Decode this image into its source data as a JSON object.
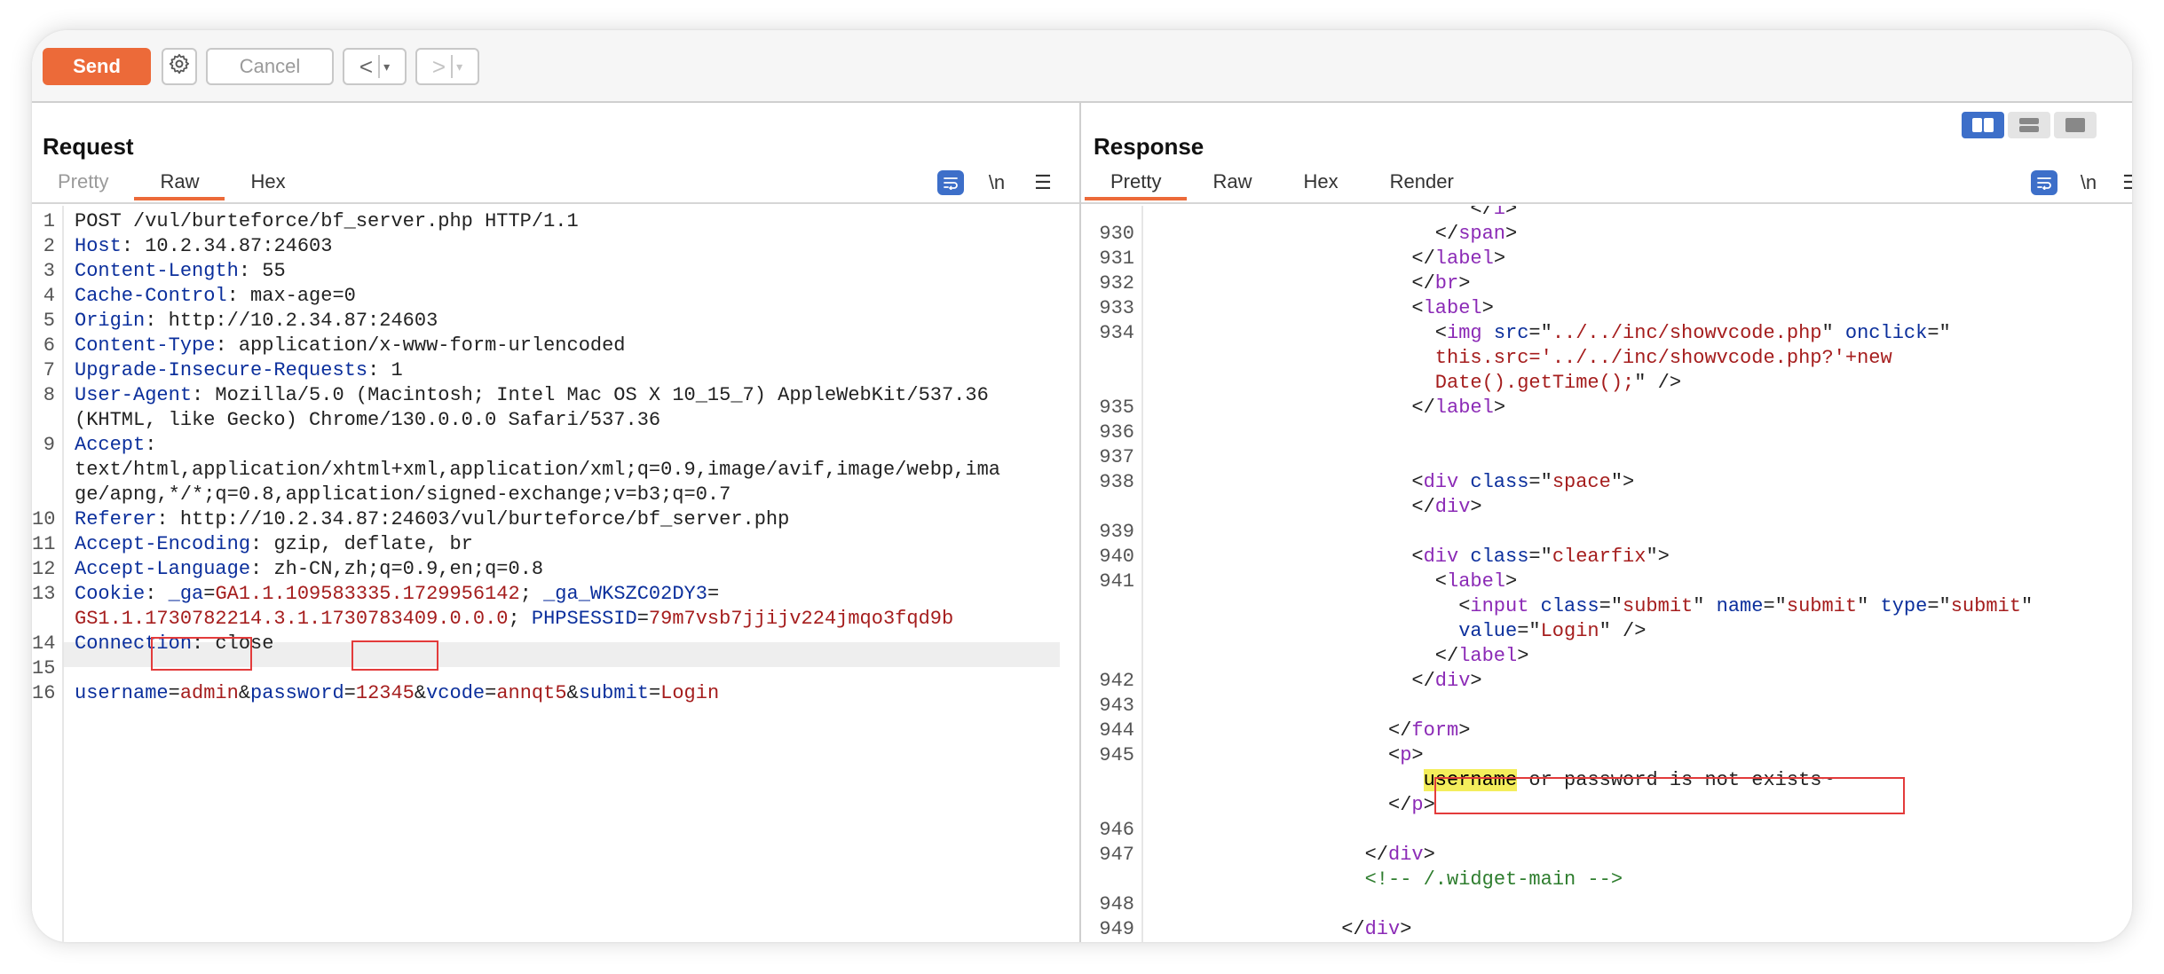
{
  "toolbar": {
    "send_label": "Send",
    "cancel_label": "Cancel",
    "prev_label": "<",
    "next_label": ">",
    "dropdown_glyph": "▾",
    "settings_icon": "gear-icon"
  },
  "request": {
    "title": "Request",
    "tabs": [
      "Pretty",
      "Raw",
      "Hex"
    ],
    "active_tab": "Raw",
    "newline_label": "\\n",
    "lines": [
      {
        "n": "1",
        "parts": [
          [
            "v",
            "POST /vul/burteforce/bf_server.php HTTP/1.1"
          ]
        ]
      },
      {
        "n": "2",
        "parts": [
          [
            "k",
            "Host"
          ],
          [
            "v",
            ": 10.2.34.87:24603"
          ]
        ]
      },
      {
        "n": "3",
        "parts": [
          [
            "k",
            "Content-Length"
          ],
          [
            "v",
            ": 55"
          ]
        ]
      },
      {
        "n": "4",
        "parts": [
          [
            "k",
            "Cache-Control"
          ],
          [
            "v",
            ": max-age=0"
          ]
        ]
      },
      {
        "n": "5",
        "parts": [
          [
            "k",
            "Origin"
          ],
          [
            "v",
            ": http://10.2.34.87:24603"
          ]
        ]
      },
      {
        "n": "6",
        "parts": [
          [
            "k",
            "Content-Type"
          ],
          [
            "v",
            ": application/x-www-form-urlencoded"
          ]
        ]
      },
      {
        "n": "7",
        "parts": [
          [
            "k",
            "Upgrade-Insecure-Requests"
          ],
          [
            "v",
            ": 1"
          ]
        ]
      },
      {
        "n": "8",
        "parts": [
          [
            "k",
            "User-Agent"
          ],
          [
            "v",
            ": Mozilla/5.0 (Macintosh; Intel Mac OS X 10_15_7) AppleWebKit/537.36"
          ]
        ]
      },
      {
        "n": "",
        "parts": [
          [
            "v",
            "(KHTML, like Gecko) Chrome/130.0.0.0 Safari/537.36"
          ]
        ]
      },
      {
        "n": "9",
        "parts": [
          [
            "k",
            "Accept"
          ],
          [
            "v",
            ":"
          ]
        ]
      },
      {
        "n": "",
        "parts": [
          [
            "v",
            "text/html,application/xhtml+xml,application/xml;q=0.9,image/avif,image/webp,ima"
          ]
        ]
      },
      {
        "n": "",
        "parts": [
          [
            "v",
            "ge/apng,*/*;q=0.8,application/signed-exchange;v=b3;q=0.7"
          ]
        ]
      },
      {
        "n": "10",
        "parts": [
          [
            "k",
            "Referer"
          ],
          [
            "v",
            ": http://10.2.34.87:24603/vul/burteforce/bf_server.php"
          ]
        ]
      },
      {
        "n": "11",
        "parts": [
          [
            "k",
            "Accept-Encoding"
          ],
          [
            "v",
            ": gzip, deflate, br"
          ]
        ]
      },
      {
        "n": "12",
        "parts": [
          [
            "k",
            "Accept-Language"
          ],
          [
            "v",
            ": zh-CN,zh;q=0.9,en;q=0.8"
          ]
        ]
      },
      {
        "n": "13",
        "parts": [
          [
            "k",
            "Cookie"
          ],
          [
            "v",
            ": "
          ],
          [
            "k",
            "_ga"
          ],
          [
            "v",
            "="
          ],
          [
            "r",
            "GA1.1.109583335.1729956142"
          ],
          [
            "v",
            "; "
          ],
          [
            "k",
            "_ga_WKSZC02DY3"
          ],
          [
            "v",
            "="
          ]
        ]
      },
      {
        "n": "",
        "parts": [
          [
            "r",
            "GS1.1.1730782214.3.1.1730783409.0.0.0"
          ],
          [
            "v",
            "; "
          ],
          [
            "k",
            "PHPSESSID"
          ],
          [
            "v",
            "="
          ],
          [
            "r",
            "79m7vsb7jjijv224jmqo3fqd9b"
          ]
        ]
      },
      {
        "n": "14",
        "parts": [
          [
            "k",
            "Connection"
          ],
          [
            "v",
            ": close"
          ]
        ]
      },
      {
        "n": "15",
        "parts": []
      },
      {
        "n": "16",
        "parts": [
          [
            "k",
            "username"
          ],
          [
            "v",
            "="
          ],
          [
            "r",
            "admin"
          ],
          [
            "v",
            "&"
          ],
          [
            "k",
            "password"
          ],
          [
            "v",
            "="
          ],
          [
            "r",
            "12345"
          ],
          [
            "v",
            "&"
          ],
          [
            "k",
            "vcode"
          ],
          [
            "v",
            "="
          ],
          [
            "r",
            "annqt5"
          ],
          [
            "v",
            "&"
          ],
          [
            "k",
            "submit"
          ],
          [
            "v",
            "="
          ],
          [
            "r",
            "Login"
          ]
        ]
      }
    ]
  },
  "response": {
    "title": "Response",
    "tabs": [
      "Pretty",
      "Raw",
      "Hex",
      "Render"
    ],
    "active_tab": "Pretty",
    "newline_label": "\\n",
    "lines": [
      {
        "n": "",
        "indent": 27,
        "parts": [
          [
            "p",
            "</"
          ],
          [
            "t",
            "i"
          ],
          [
            "p",
            ">"
          ]
        ]
      },
      {
        "n": "930",
        "indent": 24,
        "parts": [
          [
            "p",
            "</"
          ],
          [
            "t",
            "span"
          ],
          [
            "p",
            ">"
          ]
        ]
      },
      {
        "n": "931",
        "indent": 22,
        "parts": [
          [
            "p",
            "</"
          ],
          [
            "t",
            "label"
          ],
          [
            "p",
            ">"
          ]
        ]
      },
      {
        "n": "932",
        "indent": 22,
        "parts": [
          [
            "p",
            "</"
          ],
          [
            "t",
            "br"
          ],
          [
            "p",
            ">"
          ]
        ]
      },
      {
        "n": "933",
        "indent": 22,
        "parts": [
          [
            "p",
            "<"
          ],
          [
            "t",
            "label"
          ],
          [
            "p",
            ">"
          ]
        ]
      },
      {
        "n": "934",
        "indent": 24,
        "parts": [
          [
            "p",
            "<"
          ],
          [
            "t",
            "img"
          ],
          [
            "p",
            " "
          ],
          [
            "a",
            "src"
          ],
          [
            "p",
            "=\""
          ],
          [
            "s",
            "../../inc/showvcode.php"
          ],
          [
            "p",
            "\" "
          ],
          [
            "a",
            "onclick"
          ],
          [
            "p",
            "=\""
          ]
        ]
      },
      {
        "n": "",
        "indent": 24,
        "parts": [
          [
            "s",
            "this.src='../../inc/showvcode.php?'+new"
          ]
        ]
      },
      {
        "n": "",
        "indent": 24,
        "parts": [
          [
            "s",
            "Date().getTime();"
          ],
          [
            "p",
            "\" />"
          ]
        ]
      },
      {
        "n": "935",
        "indent": 22,
        "parts": [
          [
            "p",
            "</"
          ],
          [
            "t",
            "label"
          ],
          [
            "p",
            ">"
          ]
        ]
      },
      {
        "n": "936",
        "indent": 0,
        "parts": []
      },
      {
        "n": "937",
        "indent": 0,
        "parts": []
      },
      {
        "n": "938",
        "indent": 22,
        "parts": [
          [
            "p",
            "<"
          ],
          [
            "t",
            "div"
          ],
          [
            "p",
            " "
          ],
          [
            "a",
            "class"
          ],
          [
            "p",
            "=\""
          ],
          [
            "s",
            "space"
          ],
          [
            "p",
            "\">"
          ]
        ]
      },
      {
        "n": "",
        "indent": 22,
        "parts": [
          [
            "p",
            "</"
          ],
          [
            "t",
            "div"
          ],
          [
            "p",
            ">"
          ]
        ]
      },
      {
        "n": "939",
        "indent": 0,
        "parts": []
      },
      {
        "n": "940",
        "indent": 22,
        "parts": [
          [
            "p",
            "<"
          ],
          [
            "t",
            "div"
          ],
          [
            "p",
            " "
          ],
          [
            "a",
            "class"
          ],
          [
            "p",
            "=\""
          ],
          [
            "s",
            "clearfix"
          ],
          [
            "p",
            "\">"
          ]
        ]
      },
      {
        "n": "941",
        "indent": 24,
        "parts": [
          [
            "p",
            "<"
          ],
          [
            "t",
            "label"
          ],
          [
            "p",
            ">"
          ]
        ]
      },
      {
        "n": "",
        "indent": 26,
        "parts": [
          [
            "p",
            "<"
          ],
          [
            "t",
            "input"
          ],
          [
            "p",
            " "
          ],
          [
            "a",
            "class"
          ],
          [
            "p",
            "=\""
          ],
          [
            "s",
            "submit"
          ],
          [
            "p",
            "\" "
          ],
          [
            "a",
            "name"
          ],
          [
            "p",
            "=\""
          ],
          [
            "s",
            "submit"
          ],
          [
            "p",
            "\" "
          ],
          [
            "a",
            "type"
          ],
          [
            "p",
            "=\""
          ],
          [
            "s",
            "submit"
          ],
          [
            "p",
            "\""
          ]
        ]
      },
      {
        "n": "",
        "indent": 26,
        "parts": [
          [
            "a",
            "value"
          ],
          [
            "p",
            "=\""
          ],
          [
            "s",
            "Login"
          ],
          [
            "p",
            "\" />"
          ]
        ]
      },
      {
        "n": "",
        "indent": 24,
        "parts": [
          [
            "p",
            "</"
          ],
          [
            "t",
            "label"
          ],
          [
            "p",
            ">"
          ]
        ]
      },
      {
        "n": "942",
        "indent": 22,
        "parts": [
          [
            "p",
            "</"
          ],
          [
            "t",
            "div"
          ],
          [
            "p",
            ">"
          ]
        ]
      },
      {
        "n": "943",
        "indent": 0,
        "parts": []
      },
      {
        "n": "944",
        "indent": 20,
        "parts": [
          [
            "p",
            "</"
          ],
          [
            "t",
            "form"
          ],
          [
            "p",
            ">"
          ]
        ]
      },
      {
        "n": "945",
        "indent": 20,
        "parts": [
          [
            "p",
            "<"
          ],
          [
            "t",
            "p"
          ],
          [
            "p",
            ">"
          ]
        ]
      },
      {
        "n": "",
        "indent": 23,
        "parts": [
          [
            "hl",
            "username"
          ],
          [
            "p",
            " or password is not exists~"
          ]
        ]
      },
      {
        "n": "",
        "indent": 20,
        "parts": [
          [
            "p",
            "</"
          ],
          [
            "t",
            "p"
          ],
          [
            "p",
            ">"
          ]
        ]
      },
      {
        "n": "946",
        "indent": 0,
        "parts": []
      },
      {
        "n": "947",
        "indent": 18,
        "parts": [
          [
            "p",
            "</"
          ],
          [
            "t",
            "div"
          ],
          [
            "p",
            ">"
          ]
        ]
      },
      {
        "n": "",
        "indent": 18,
        "parts": [
          [
            "c",
            "<!-- /.widget-main -->"
          ]
        ]
      },
      {
        "n": "948",
        "indent": 0,
        "parts": []
      },
      {
        "n": "949",
        "indent": 16,
        "parts": [
          [
            "p",
            "</"
          ],
          [
            "t",
            "div"
          ],
          [
            "p",
            ">"
          ]
        ]
      }
    ]
  }
}
